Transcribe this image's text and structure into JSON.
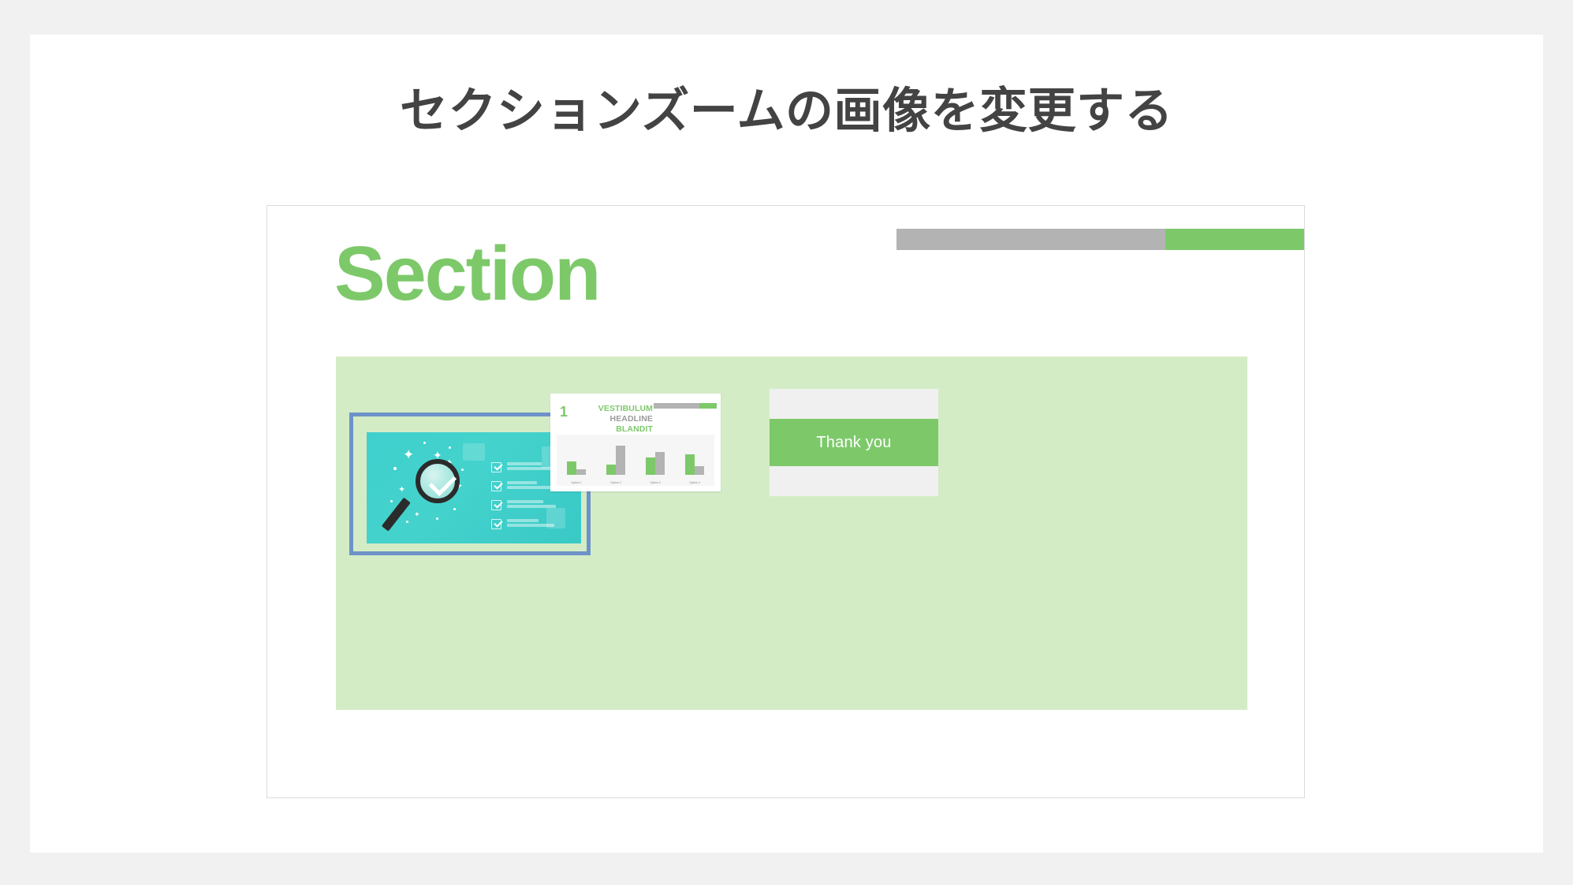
{
  "page": {
    "title": "セクションズームの画像を変更する",
    "background_color": "#f1f1f1",
    "card_color": "#ffffff",
    "title_color": "#434343"
  },
  "slide": {
    "title": "Section",
    "title_color": "#7dc96a",
    "progress_bar": {
      "gray_percent": 66,
      "green_percent": 34,
      "gray_color": "#b3b3b3",
      "green_color": "#7dc96a"
    },
    "panel_color": "#d4ecc6",
    "selection_border_color": "#6e92c8"
  },
  "thumbnails": [
    {
      "name": "magnifier-checklist-image",
      "selected": true,
      "image_description": "magnifying-glass-checklist-icon",
      "background_color": "#3fd0cd"
    },
    {
      "name": "vestibulum-chart-slide",
      "selected": false,
      "number": "1",
      "heading_line_1": "VESTIBULUM",
      "heading_line_2": "HEADLINE",
      "heading_line_3": "BLANDIT",
      "heading_color_1": "#7dc96a",
      "heading_color_2": "#9b9b9b",
      "heading_color_3": "#7dc96a",
      "progress_bar": {
        "gray_percent": 72,
        "green_percent": 28
      },
      "chart_data": {
        "type": "bar",
        "categories": [
          "Option 1",
          "Option 2",
          "Option 3",
          "Option 4"
        ],
        "series": [
          {
            "name": "Green",
            "color": "#7dc96a",
            "values": [
              38,
              28,
              50,
              57
            ]
          },
          {
            "name": "Gray",
            "color": "#b3b3b3",
            "values": [
              15,
              82,
              65,
              24
            ]
          }
        ],
        "title": "",
        "xlabel": "",
        "ylabel": "",
        "ylim": [
          0,
          100
        ],
        "grid": false,
        "legend": "none"
      }
    },
    {
      "name": "thank-you-slide",
      "selected": false,
      "text": "Thank you",
      "band_color": "#7dc96a",
      "strip_color": "#f0f0f0",
      "text_color": "#ffffff"
    }
  ]
}
